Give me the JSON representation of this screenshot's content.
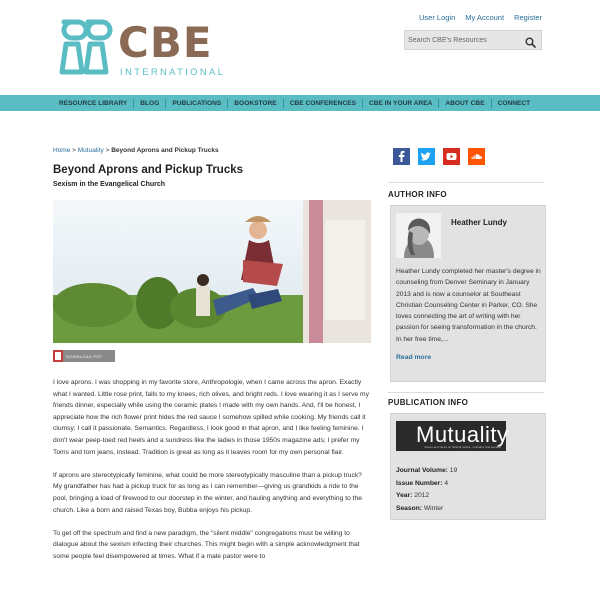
{
  "brand": {
    "name": "CBE",
    "tagline": "INTERNATIONAL",
    "colors": {
      "teal": "#5bbdc4",
      "brown": "#8a6a55",
      "link": "#2a6e9a"
    }
  },
  "top_links": [
    "User Login",
    "My Account",
    "Register"
  ],
  "search": {
    "placeholder": "Search CBE's Resources",
    "icon": "magnifier-icon"
  },
  "nav": [
    "RESOURCE LIBRARY",
    "BLOG",
    "PUBLICATIONS",
    "BOOKSTORE",
    "CBE CONFERENCES",
    "CBE IN YOUR AREA",
    "ABOUT CBE",
    "CONNECT"
  ],
  "breadcrumb": {
    "home": "Home",
    "sep1": " > ",
    "section": "Mutuality",
    "sep2": " > ",
    "current": "Beyond Aprons and Pickup Trucks"
  },
  "article": {
    "title": "Beyond Aprons and Pickup Trucks",
    "subtitle": "Sexism in the Evangelical Church",
    "pdf_label": "DOWNLOAD PDF",
    "paragraphs": [
      "I love aprons. I was shopping in my favorite store, Anthropologie, when I came across the apron. Exactly what I wanted. Little rose print, falls to my knees, rich olives, and bright reds. I love wearing it as I serve my friends dinner, especially while using the ceramic plates I made with my own hands. And, I'll be honest, I appreciate how the rich flower print hides the red sauce I somehow spilled while cooking. My friends call it clumsy; I call it passionate. Semantics. Regardless, I look good in that apron, and I like feeling feminine. I don't wear peep-toed red heels and a sundress like the ladies in those 1950s magazine ads; I prefer my Toms and torn jeans, instead. Tradition is great as long as it leaves room for my own personal flair.",
      "If aprons are stereotypically feminine, what could be more stereotypically masculine than a pickup truck? My grandfather has had a pickup truck for as long as I can remember—giving us grandkids a ride to the pool, bringing a load of firewood to our doorstep in the winter, and hauling anything and everything to the church. Like a born and raised Texas boy, Bubba enjoys his pickup.",
      "To get off the spectrum and find a new paradigm, the \"silent middle\" congregations must be willing to dialogue about the sexism infecting their churches. This might begin with a simple acknowledgment that some people feel disempowered at times. What if a male pastor were to"
    ]
  },
  "social": [
    {
      "name": "facebook-icon",
      "color": "#3b5998"
    },
    {
      "name": "twitter-icon",
      "color": "#1da1f2"
    },
    {
      "name": "youtube-icon",
      "color": "#d62d20"
    },
    {
      "name": "soundcloud-icon",
      "color": "#ff5500"
    }
  ],
  "author_info": {
    "heading": "AUTHOR INFO",
    "name": "Heather Lundy",
    "bio": "Heather Lundy completed her master's degree in counseling from Denver Seminary in January 2013 and is now a counselor at Southeast Christian Counseling Center in Parker, CO. She loves connecting the art of writing with her passion for seeing transformation in the church. In her free time,...",
    "read_more": "Read more"
  },
  "publication_info": {
    "heading": "PUBLICATION INFO",
    "logo_text": "Mutuality",
    "logo_subtext": "Voices and views on biblical justice, mutuality and equality",
    "journal_volume_label": "Journal Volume:",
    "journal_volume": "19",
    "issue_label": "Issue Number:",
    "issue": "4",
    "year_label": "Year:",
    "year": "2012",
    "season_label": "Season:",
    "season": "Winter"
  }
}
